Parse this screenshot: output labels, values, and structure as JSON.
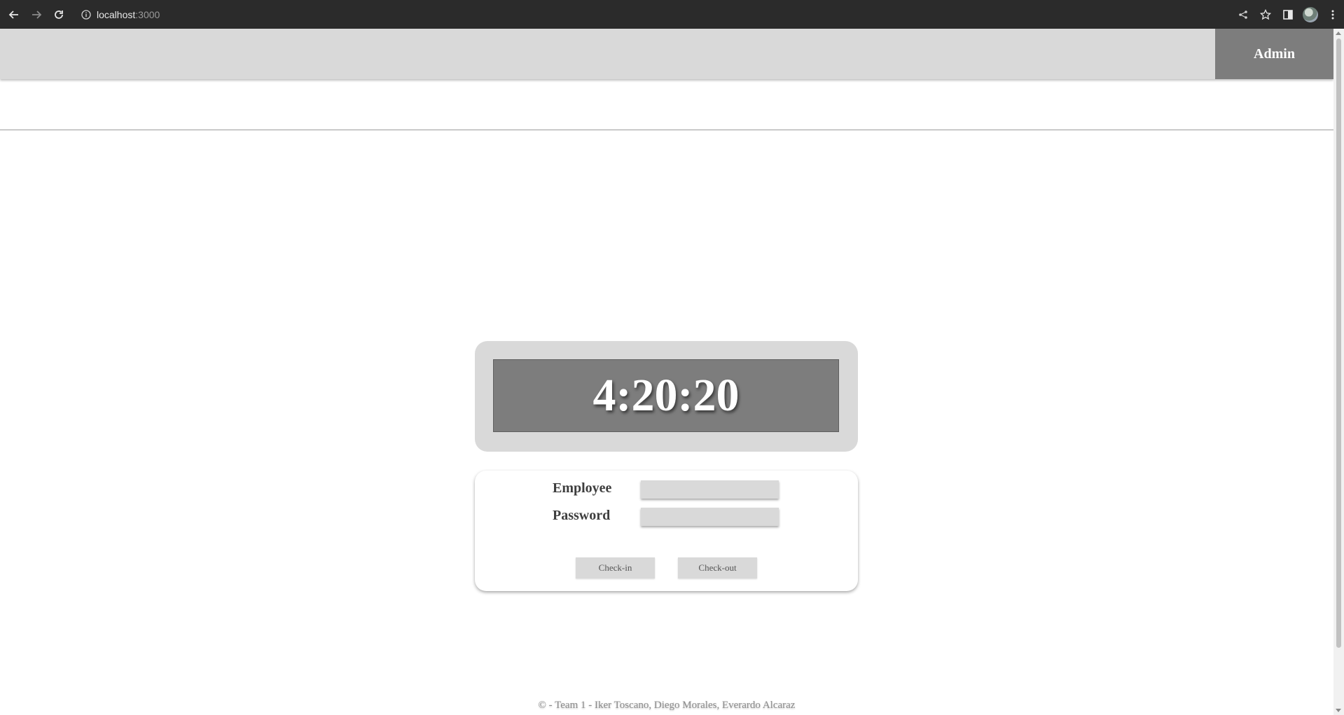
{
  "browser": {
    "url_host": "localhost",
    "url_port": ":3000",
    "icons": {
      "back": "arrow-left-icon",
      "forward": "arrow-right-icon",
      "reload": "reload-icon",
      "site_info": "info-icon",
      "share": "share-icon",
      "bookmark": "star-icon",
      "side_panel": "side-panel-icon",
      "profile": "avatar",
      "menu": "kebab-menu-icon"
    }
  },
  "header": {
    "admin_label": "Admin"
  },
  "clock": {
    "time": "4:20:20"
  },
  "form": {
    "employee_label": "Employee",
    "employee_value": "",
    "password_label": "Password",
    "password_value": "",
    "checkin_label": "Check-in",
    "checkout_label": "Check-out"
  },
  "footer": {
    "text": "© - Team 1 - Iker Toscano, Diego Morales, Everardo Alcaraz"
  },
  "colors": {
    "header_bg": "#d9d9d9",
    "admin_bg": "#7d7d7d",
    "clock_face": "#7d7d7d",
    "chrome_bg": "#2b2b2b"
  }
}
